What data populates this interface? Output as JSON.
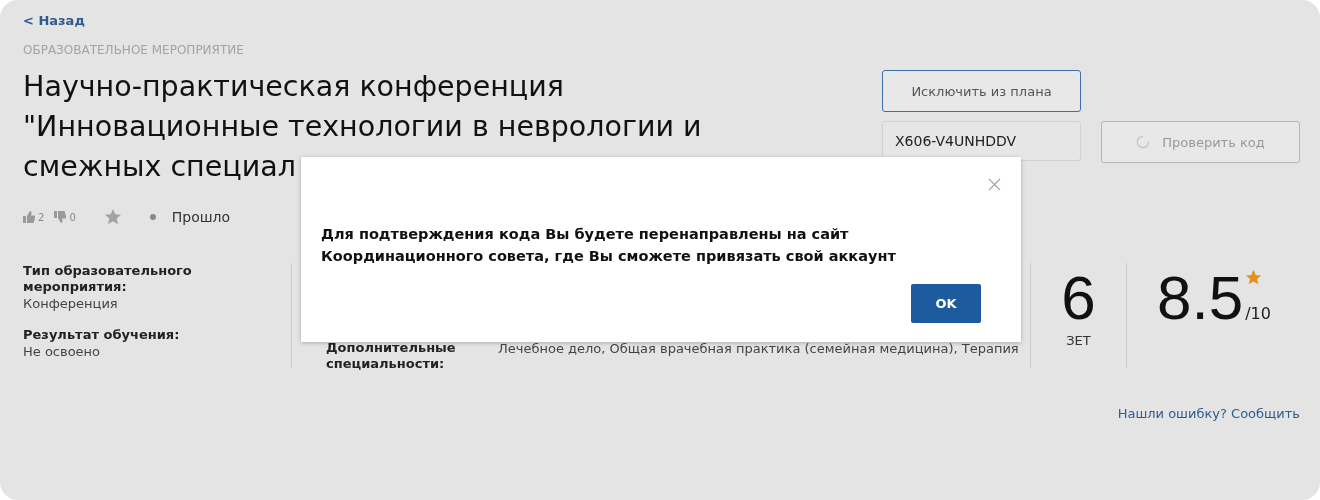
{
  "back_link": "< Назад",
  "category": "ОБРАЗОВАТЕЛЬНОЕ МЕРОПРИЯТИЕ",
  "title": "Научно-практическая конференция\n\"Инновационные технологии в неврологии и\nсмежных специал",
  "reactions": {
    "likes": "2",
    "dislikes": "0",
    "favorite": false,
    "status": "Прошло"
  },
  "actions": {
    "exclude_button": "Исключить из плана",
    "code_field": {
      "value": "X606-V4UNHDDV"
    },
    "check_button": {
      "label": "Проверить код",
      "disabled": true,
      "loading": true
    }
  },
  "details": [
    {
      "label": "Тип образовательного мероприятия:",
      "value": "Конференция"
    },
    {
      "label": "Результат обучения:",
      "value": "Не освоено"
    }
  ],
  "specialties": {
    "label": "Дополнительные специальности:",
    "value": "Лечебное дело, Общая врачебная практика (семейная медицина), Терапия"
  },
  "credits": {
    "value": "6",
    "unit": "ЗЕТ"
  },
  "rating": {
    "value": "8.5",
    "scale": "/10"
  },
  "report_link": "Нашли ошибку? Сообщить",
  "modal": {
    "message": "Для подтверждения кода Вы будете перенаправлены на сайт Координационного совета, где Вы сможете привязать свой аккаунт",
    "ok_button": "OK"
  }
}
